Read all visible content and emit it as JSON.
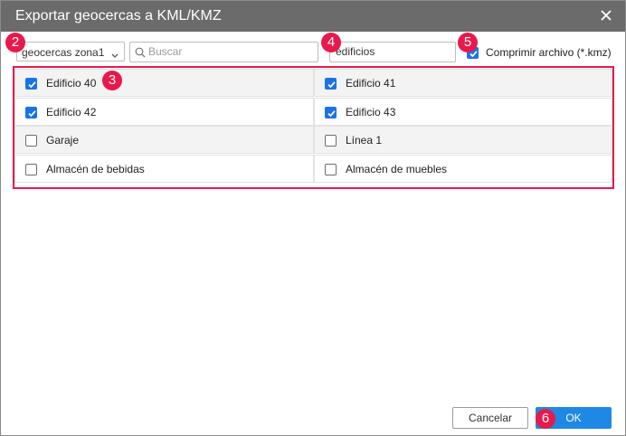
{
  "dialog": {
    "title": "Exportar geocercas a KML/KMZ"
  },
  "toolbar": {
    "group_select_value": "geocercas zona1",
    "search_placeholder": "Buscar",
    "filter_value": "edificios",
    "compress_label": "Comprimir archivo (*.kmz)",
    "compress_checked": true
  },
  "badges": [
    "2",
    "3",
    "4",
    "5",
    "6"
  ],
  "geofences": [
    {
      "label": "Edificio 40",
      "checked": true
    },
    {
      "label": "Edificio 41",
      "checked": true
    },
    {
      "label": "Edificio 42",
      "checked": true
    },
    {
      "label": "Edificio 43",
      "checked": true
    },
    {
      "label": "Garaje",
      "checked": false
    },
    {
      "label": "Línea 1",
      "checked": false
    },
    {
      "label": "Almacén de bebidas",
      "checked": false
    },
    {
      "label": "Almacén de muebles",
      "checked": false
    }
  ],
  "buttons": {
    "cancel": "Cancelar",
    "ok": "OK"
  },
  "colors": {
    "title_bar": "#6b6b6b",
    "badge": "#e8194b",
    "accent": "#1a73e8",
    "ok_button": "#1e88e5"
  },
  "icons": {
    "close": "close-icon",
    "search": "search-icon",
    "dropdown": "chevron-down-icon",
    "checkbox": "checkmark-icon"
  }
}
